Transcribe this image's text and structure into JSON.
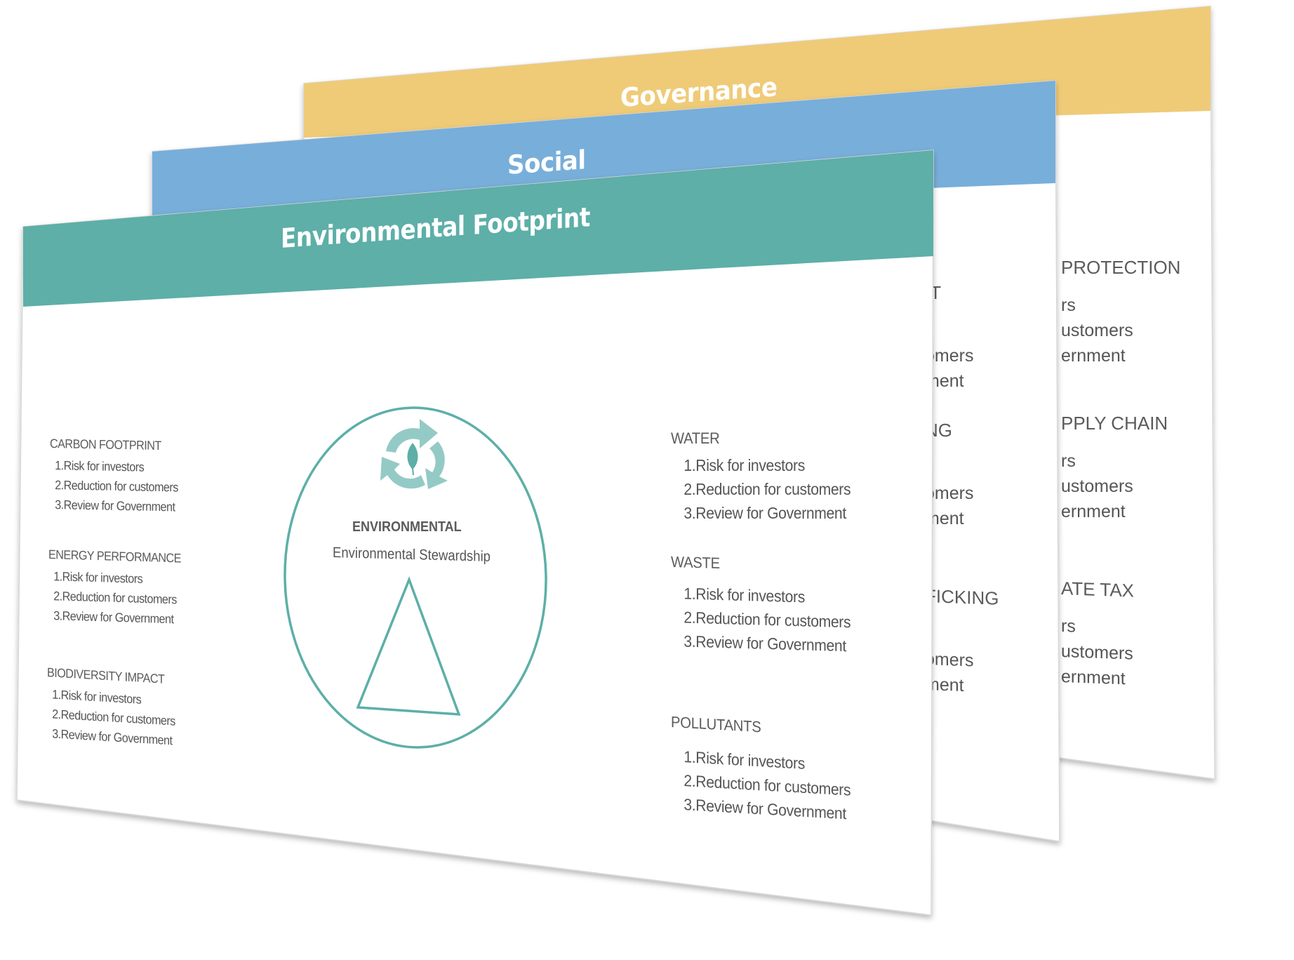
{
  "colors": {
    "governance": "#EFCB78",
    "social": "#78AEDA",
    "environmental": "#5DAFA8",
    "icon_light": "#94CAC5",
    "text": "#555555"
  },
  "cards": {
    "governance": {
      "title": "Governance",
      "visible_sections": [
        {
          "heading": "PROTECTION",
          "items": [
            "rs",
            "ustomers",
            "ernment"
          ]
        },
        {
          "heading": "PPLY CHAIN",
          "items": [
            "rs",
            "ustomers",
            "ernment"
          ]
        },
        {
          "heading": "ATE TAX",
          "items": [
            "rs",
            "ustomers",
            "ernment"
          ]
        }
      ]
    },
    "social": {
      "title": "Social",
      "visible_sections": [
        {
          "heading": "IT",
          "items": [
            "",
            "omers",
            "ment"
          ]
        },
        {
          "heading": "NG",
          "items": [
            "",
            "omers",
            "ment"
          ]
        },
        {
          "heading": "FICKING",
          "items": [
            "",
            "omers",
            "ment"
          ]
        }
      ]
    },
    "environmental": {
      "title": "Environmental Footprint",
      "center": {
        "icon": "recycle-leaf-icon",
        "label": "ENVIRONMENTAL",
        "sublabel": "Environmental Stewardship",
        "shape": "triangle-outline-icon"
      },
      "left_sections": [
        {
          "heading": "CARBON FOOTPRINT",
          "items": [
            "1.Risk for investors",
            "2.Reduction for customers",
            "3.Review for Government"
          ]
        },
        {
          "heading": "ENERGY PERFORMANCE",
          "items": [
            "1.Risk for investors",
            "2.Reduction for customers",
            "3.Review for Government"
          ]
        },
        {
          "heading": "BIODIVERSITY IMPACT",
          "items": [
            "1.Risk for investors",
            "2.Reduction for customers",
            "3.Review for Government"
          ]
        }
      ],
      "right_sections": [
        {
          "heading": "WATER",
          "items": [
            "1.Risk for investors",
            "2.Reduction for customers",
            "3.Review for Government"
          ]
        },
        {
          "heading": "WASTE",
          "items": [
            "1.Risk for investors",
            "2.Reduction for customers",
            "3.Review for Government"
          ]
        },
        {
          "heading": "POLLUTANTS",
          "items": [
            "1.Risk for investors",
            "2.Reduction for customers",
            "3.Review for Government"
          ]
        }
      ]
    }
  }
}
